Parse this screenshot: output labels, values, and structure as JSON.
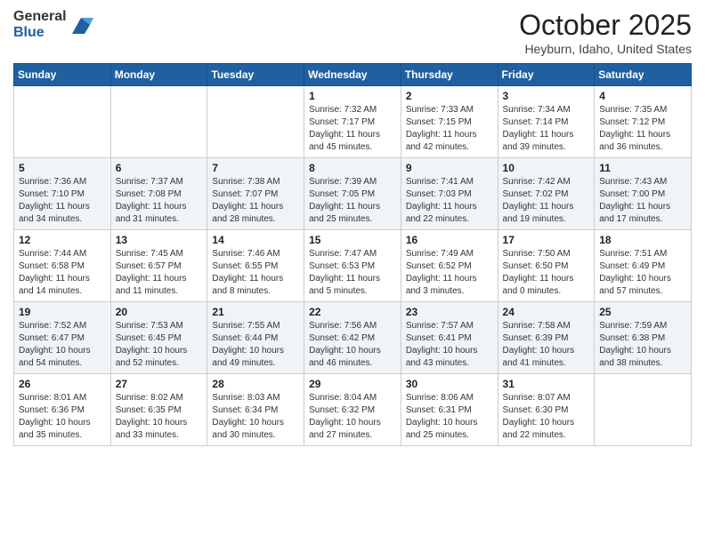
{
  "header": {
    "logo_general": "General",
    "logo_blue": "Blue",
    "month": "October 2025",
    "location": "Heyburn, Idaho, United States"
  },
  "weekdays": [
    "Sunday",
    "Monday",
    "Tuesday",
    "Wednesday",
    "Thursday",
    "Friday",
    "Saturday"
  ],
  "weeks": [
    [
      {
        "day": "",
        "sunrise": "",
        "sunset": "",
        "daylight": ""
      },
      {
        "day": "",
        "sunrise": "",
        "sunset": "",
        "daylight": ""
      },
      {
        "day": "",
        "sunrise": "",
        "sunset": "",
        "daylight": ""
      },
      {
        "day": "1",
        "sunrise": "Sunrise: 7:32 AM",
        "sunset": "Sunset: 7:17 PM",
        "daylight": "Daylight: 11 hours and 45 minutes."
      },
      {
        "day": "2",
        "sunrise": "Sunrise: 7:33 AM",
        "sunset": "Sunset: 7:15 PM",
        "daylight": "Daylight: 11 hours and 42 minutes."
      },
      {
        "day": "3",
        "sunrise": "Sunrise: 7:34 AM",
        "sunset": "Sunset: 7:14 PM",
        "daylight": "Daylight: 11 hours and 39 minutes."
      },
      {
        "day": "4",
        "sunrise": "Sunrise: 7:35 AM",
        "sunset": "Sunset: 7:12 PM",
        "daylight": "Daylight: 11 hours and 36 minutes."
      }
    ],
    [
      {
        "day": "5",
        "sunrise": "Sunrise: 7:36 AM",
        "sunset": "Sunset: 7:10 PM",
        "daylight": "Daylight: 11 hours and 34 minutes."
      },
      {
        "day": "6",
        "sunrise": "Sunrise: 7:37 AM",
        "sunset": "Sunset: 7:08 PM",
        "daylight": "Daylight: 11 hours and 31 minutes."
      },
      {
        "day": "7",
        "sunrise": "Sunrise: 7:38 AM",
        "sunset": "Sunset: 7:07 PM",
        "daylight": "Daylight: 11 hours and 28 minutes."
      },
      {
        "day": "8",
        "sunrise": "Sunrise: 7:39 AM",
        "sunset": "Sunset: 7:05 PM",
        "daylight": "Daylight: 11 hours and 25 minutes."
      },
      {
        "day": "9",
        "sunrise": "Sunrise: 7:41 AM",
        "sunset": "Sunset: 7:03 PM",
        "daylight": "Daylight: 11 hours and 22 minutes."
      },
      {
        "day": "10",
        "sunrise": "Sunrise: 7:42 AM",
        "sunset": "Sunset: 7:02 PM",
        "daylight": "Daylight: 11 hours and 19 minutes."
      },
      {
        "day": "11",
        "sunrise": "Sunrise: 7:43 AM",
        "sunset": "Sunset: 7:00 PM",
        "daylight": "Daylight: 11 hours and 17 minutes."
      }
    ],
    [
      {
        "day": "12",
        "sunrise": "Sunrise: 7:44 AM",
        "sunset": "Sunset: 6:58 PM",
        "daylight": "Daylight: 11 hours and 14 minutes."
      },
      {
        "day": "13",
        "sunrise": "Sunrise: 7:45 AM",
        "sunset": "Sunset: 6:57 PM",
        "daylight": "Daylight: 11 hours and 11 minutes."
      },
      {
        "day": "14",
        "sunrise": "Sunrise: 7:46 AM",
        "sunset": "Sunset: 6:55 PM",
        "daylight": "Daylight: 11 hours and 8 minutes."
      },
      {
        "day": "15",
        "sunrise": "Sunrise: 7:47 AM",
        "sunset": "Sunset: 6:53 PM",
        "daylight": "Daylight: 11 hours and 5 minutes."
      },
      {
        "day": "16",
        "sunrise": "Sunrise: 7:49 AM",
        "sunset": "Sunset: 6:52 PM",
        "daylight": "Daylight: 11 hours and 3 minutes."
      },
      {
        "day": "17",
        "sunrise": "Sunrise: 7:50 AM",
        "sunset": "Sunset: 6:50 PM",
        "daylight": "Daylight: 11 hours and 0 minutes."
      },
      {
        "day": "18",
        "sunrise": "Sunrise: 7:51 AM",
        "sunset": "Sunset: 6:49 PM",
        "daylight": "Daylight: 10 hours and 57 minutes."
      }
    ],
    [
      {
        "day": "19",
        "sunrise": "Sunrise: 7:52 AM",
        "sunset": "Sunset: 6:47 PM",
        "daylight": "Daylight: 10 hours and 54 minutes."
      },
      {
        "day": "20",
        "sunrise": "Sunrise: 7:53 AM",
        "sunset": "Sunset: 6:45 PM",
        "daylight": "Daylight: 10 hours and 52 minutes."
      },
      {
        "day": "21",
        "sunrise": "Sunrise: 7:55 AM",
        "sunset": "Sunset: 6:44 PM",
        "daylight": "Daylight: 10 hours and 49 minutes."
      },
      {
        "day": "22",
        "sunrise": "Sunrise: 7:56 AM",
        "sunset": "Sunset: 6:42 PM",
        "daylight": "Daylight: 10 hours and 46 minutes."
      },
      {
        "day": "23",
        "sunrise": "Sunrise: 7:57 AM",
        "sunset": "Sunset: 6:41 PM",
        "daylight": "Daylight: 10 hours and 43 minutes."
      },
      {
        "day": "24",
        "sunrise": "Sunrise: 7:58 AM",
        "sunset": "Sunset: 6:39 PM",
        "daylight": "Daylight: 10 hours and 41 minutes."
      },
      {
        "day": "25",
        "sunrise": "Sunrise: 7:59 AM",
        "sunset": "Sunset: 6:38 PM",
        "daylight": "Daylight: 10 hours and 38 minutes."
      }
    ],
    [
      {
        "day": "26",
        "sunrise": "Sunrise: 8:01 AM",
        "sunset": "Sunset: 6:36 PM",
        "daylight": "Daylight: 10 hours and 35 minutes."
      },
      {
        "day": "27",
        "sunrise": "Sunrise: 8:02 AM",
        "sunset": "Sunset: 6:35 PM",
        "daylight": "Daylight: 10 hours and 33 minutes."
      },
      {
        "day": "28",
        "sunrise": "Sunrise: 8:03 AM",
        "sunset": "Sunset: 6:34 PM",
        "daylight": "Daylight: 10 hours and 30 minutes."
      },
      {
        "day": "29",
        "sunrise": "Sunrise: 8:04 AM",
        "sunset": "Sunset: 6:32 PM",
        "daylight": "Daylight: 10 hours and 27 minutes."
      },
      {
        "day": "30",
        "sunrise": "Sunrise: 8:06 AM",
        "sunset": "Sunset: 6:31 PM",
        "daylight": "Daylight: 10 hours and 25 minutes."
      },
      {
        "day": "31",
        "sunrise": "Sunrise: 8:07 AM",
        "sunset": "Sunset: 6:30 PM",
        "daylight": "Daylight: 10 hours and 22 minutes."
      },
      {
        "day": "",
        "sunrise": "",
        "sunset": "",
        "daylight": ""
      }
    ]
  ]
}
